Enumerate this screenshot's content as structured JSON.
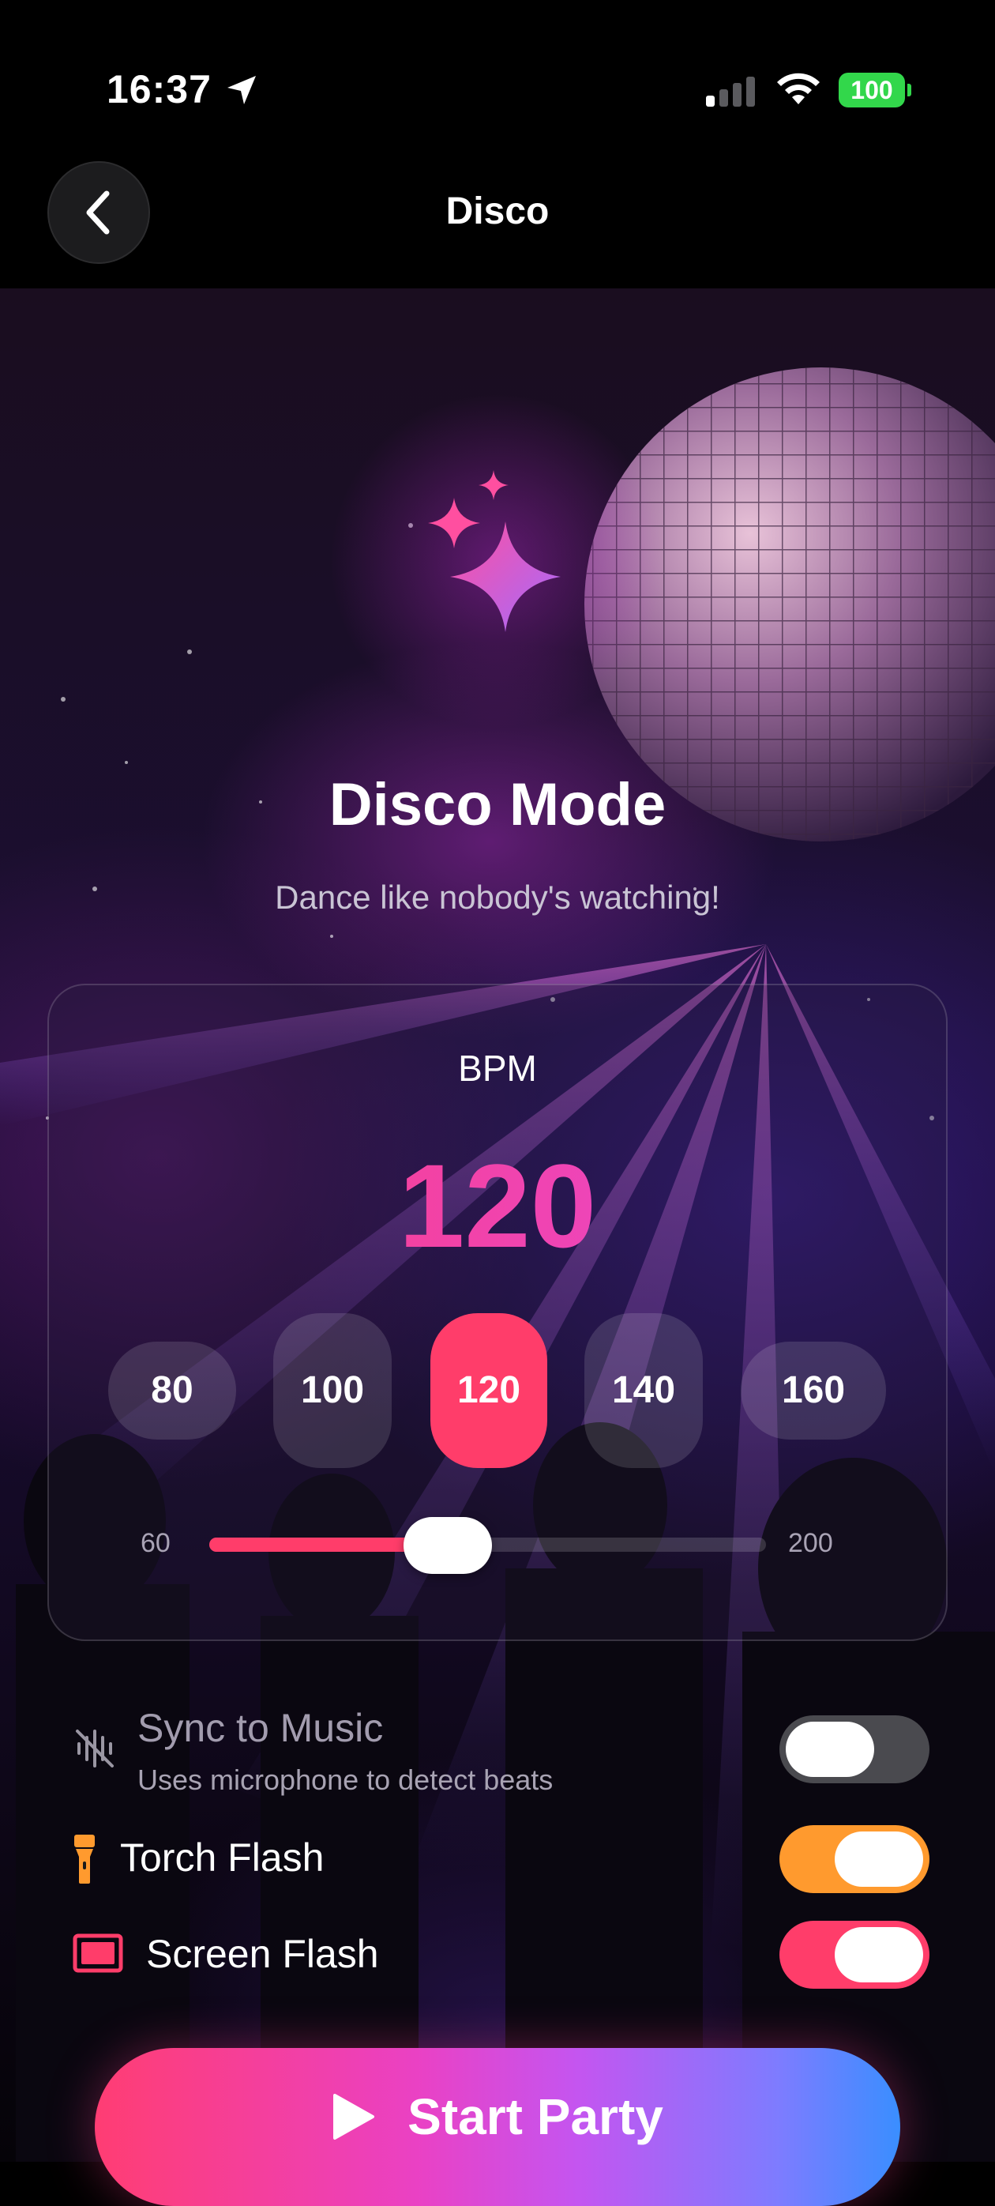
{
  "status_bar": {
    "time": "16:37",
    "battery": "100",
    "battery_color": "#32d74b"
  },
  "nav": {
    "title": "Disco"
  },
  "hero": {
    "title": "Disco Mode",
    "subtitle": "Dance like nobody's watching!"
  },
  "bpm": {
    "label": "BPM",
    "value": "120",
    "presets": [
      "80",
      "100",
      "120",
      "140",
      "160"
    ],
    "selected_preset": "120",
    "slider": {
      "min_label": "60",
      "max_label": "200",
      "min": 60,
      "max": 200,
      "value": 120
    }
  },
  "settings": {
    "sync": {
      "label": "Sync to Music",
      "description": "Uses microphone to detect beats",
      "enabled": false
    },
    "torch": {
      "label": "Torch Flash",
      "enabled": true
    },
    "screen": {
      "label": "Screen Flash",
      "enabled": true
    }
  },
  "colors": {
    "accent": "#ff3d6a",
    "torch": "#ff9a2e",
    "toggle_off": "#4a4a4f"
  },
  "actions": {
    "start_label": "Start Party"
  }
}
